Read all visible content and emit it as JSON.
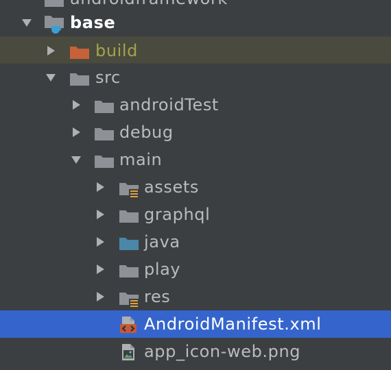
{
  "tree": {
    "partial_top_label": "androidframework",
    "items": [
      {
        "label": "base",
        "icon": "module-folder-icon"
      },
      {
        "label": "build",
        "icon": "excluded-folder-icon"
      },
      {
        "label": "src",
        "icon": "folder-icon"
      },
      {
        "label": "androidTest",
        "icon": "folder-icon"
      },
      {
        "label": "debug",
        "icon": "folder-icon"
      },
      {
        "label": "main",
        "icon": "folder-icon"
      },
      {
        "label": "assets",
        "icon": "resource-folder-icon"
      },
      {
        "label": "graphql",
        "icon": "folder-icon"
      },
      {
        "label": "java",
        "icon": "source-folder-icon"
      },
      {
        "label": "play",
        "icon": "folder-icon"
      },
      {
        "label": "res",
        "icon": "resource-folder-icon"
      },
      {
        "label": "AndroidManifest.xml",
        "icon": "xml-file-icon"
      },
      {
        "label": "app_icon-web.png",
        "icon": "image-file-icon"
      }
    ]
  },
  "colors": {
    "background": "#3c3f41",
    "selection": "#3565cc",
    "excluded_row": "#4a4b3e",
    "excluded_text": "#a3a34f",
    "folder": "#8e9297",
    "source_folder": "#4b87a9",
    "excluded_folder": "#c7613a",
    "resource_badge": "#e0a33a"
  }
}
